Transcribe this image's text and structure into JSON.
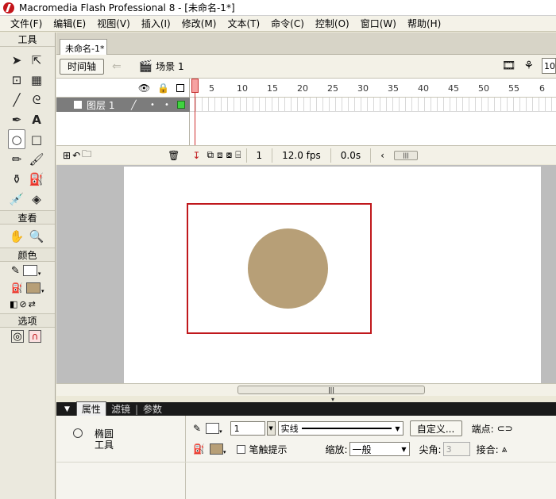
{
  "window": {
    "title": "Macromedia Flash Professional 8 - [未命名-1*]"
  },
  "menu": [
    "文件(F)",
    "编辑(E)",
    "视图(V)",
    "插入(I)",
    "修改(M)",
    "文本(T)",
    "命令(C)",
    "控制(O)",
    "窗口(W)",
    "帮助(H)"
  ],
  "tools": {
    "header": "工具",
    "view_label": "查看",
    "color_label": "颜色",
    "options_label": "选项",
    "stroke_color": "#ffffff",
    "fill_color": "#b79f77"
  },
  "document": {
    "tab_label": "未命名-1*"
  },
  "timeline_bar": {
    "timeline_button": "时间轴",
    "scene_label": "场景 1",
    "zoom_value": "10"
  },
  "timeline": {
    "ruler": [
      "5",
      "10",
      "15",
      "20",
      "25",
      "30",
      "35",
      "40",
      "45",
      "50",
      "55",
      "6"
    ],
    "layer": {
      "name": "图层 1",
      "color": "#3fd43f"
    },
    "current_frame": "1",
    "frame_rate": "12.0 fps",
    "elapsed": "0.0s"
  },
  "stage": {
    "shape_color": "#b79f77",
    "selection_color": "#c0181c"
  },
  "properties": {
    "tabs": [
      "属性",
      "滤镜",
      "参数"
    ],
    "tool_name_line1": "椭圆",
    "tool_name_line2": "工具",
    "stroke_width": "1",
    "stroke_style": "实线",
    "custom_button": "自定义...",
    "cap_label": "端点:",
    "hinting_label": "笔触提示",
    "scale_label": "缩放:",
    "scale_value": "一般",
    "miter_label": "尖角:",
    "miter_value": "3",
    "join_label": "接合:"
  }
}
